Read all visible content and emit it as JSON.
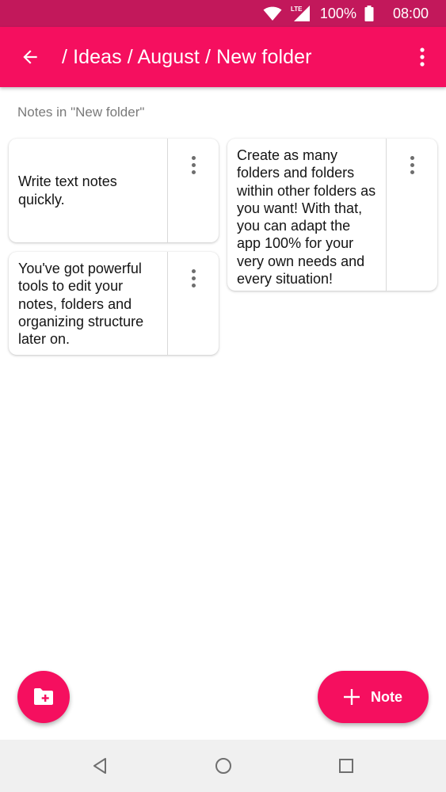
{
  "status_bar": {
    "network": "LTE",
    "battery": "100%",
    "time": "08:00"
  },
  "app_bar": {
    "title": "/ Ideas / August / New folder"
  },
  "section": {
    "label": "Notes in \"New folder\""
  },
  "notes": [
    {
      "text": "Write text notes quickly."
    },
    {
      "text": "You've got powerful tools to edit your notes, folders and organizing structure later on."
    },
    {
      "text": "Create as many folders and folders within other folders as you want! With that, you can adapt the app 100% for your very own needs and every situation!"
    }
  ],
  "fab": {
    "note_label": "Note"
  },
  "colors": {
    "status_bar": "#c2185b",
    "accent": "#f50f5f",
    "nav_bar": "#f0f0f0"
  }
}
